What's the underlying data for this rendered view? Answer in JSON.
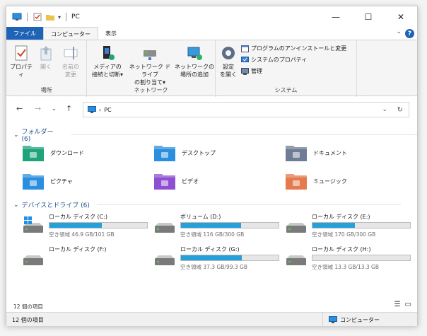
{
  "window": {
    "title": "PC"
  },
  "ribbon_tabs": {
    "file": "ファイル",
    "computer": "コンピューター",
    "view": "表示"
  },
  "ribbon": {
    "location": {
      "label": "場所",
      "properties": "プロパティ",
      "open": "開く",
      "rename_1": "名前の",
      "rename_2": "変更"
    },
    "network": {
      "label": "ネットワーク",
      "media_1": "メディアの",
      "media_2": "接続と切断",
      "map_1": "ネットワーク ドライブ",
      "map_2": "の割り当て",
      "add_1": "ネットワークの",
      "add_2": "場所の追加"
    },
    "system": {
      "label": "システム",
      "settings_1": "設定",
      "settings_2": "を開く",
      "uninstall": "プログラムのアンインストールと変更",
      "sysprops": "システムのプロパティ",
      "manage": "管理"
    }
  },
  "address": {
    "path": "PC"
  },
  "folders": {
    "header": "フォルダー (6)",
    "items": [
      {
        "label": "ダウンロード",
        "icon": "downloads-folder-icon",
        "color": "#1fa37a"
      },
      {
        "label": "デスクトップ",
        "icon": "desktop-folder-icon",
        "color": "#2b8fe0"
      },
      {
        "label": "ドキュメント",
        "icon": "documents-folder-icon",
        "color": "#6e7d93"
      },
      {
        "label": "ピクチャ",
        "icon": "pictures-folder-icon",
        "color": "#2b8fe0"
      },
      {
        "label": "ビデオ",
        "icon": "videos-folder-icon",
        "color": "#8e4fd1"
      },
      {
        "label": "ミュージック",
        "icon": "music-folder-icon",
        "color": "#e57a4f"
      }
    ]
  },
  "drives": {
    "header": "デバイスとドライブ (6)",
    "items": [
      {
        "name": "ローカル ディスク (C:)",
        "free": "空き領域 46.9 GB/101 GB",
        "used_fraction": 0.535,
        "system": true,
        "has_bar": true
      },
      {
        "name": "ボリューム (D:)",
        "free": "空き領域 116 GB/300 GB",
        "used_fraction": 0.613,
        "system": false,
        "has_bar": true
      },
      {
        "name": "ローカル ディスク (E:)",
        "free": "空き領域 170 GB/300 GB",
        "used_fraction": 0.433,
        "system": false,
        "has_bar": true
      },
      {
        "name": "ローカル ディスク (F:)",
        "free": "",
        "used_fraction": 0,
        "system": false,
        "has_bar": false
      },
      {
        "name": "ローカル ディスク (G:)",
        "free": "空き領域 37.3 GB/99.3 GB",
        "used_fraction": 0.624,
        "system": false,
        "has_bar": true
      },
      {
        "name": "ローカル ディスク (H:)",
        "free": "空き領域 13.3 GB/13.3 GB",
        "used_fraction": 0.0,
        "system": false,
        "has_bar": true
      }
    ]
  },
  "inner_status": "12 個の項目",
  "status": {
    "count": "12 個の項目",
    "location": "コンピューター"
  },
  "colors": {
    "accent": "#1f63b8",
    "bar_fill": "#26a0da",
    "header_blue": "#1d4f91"
  }
}
